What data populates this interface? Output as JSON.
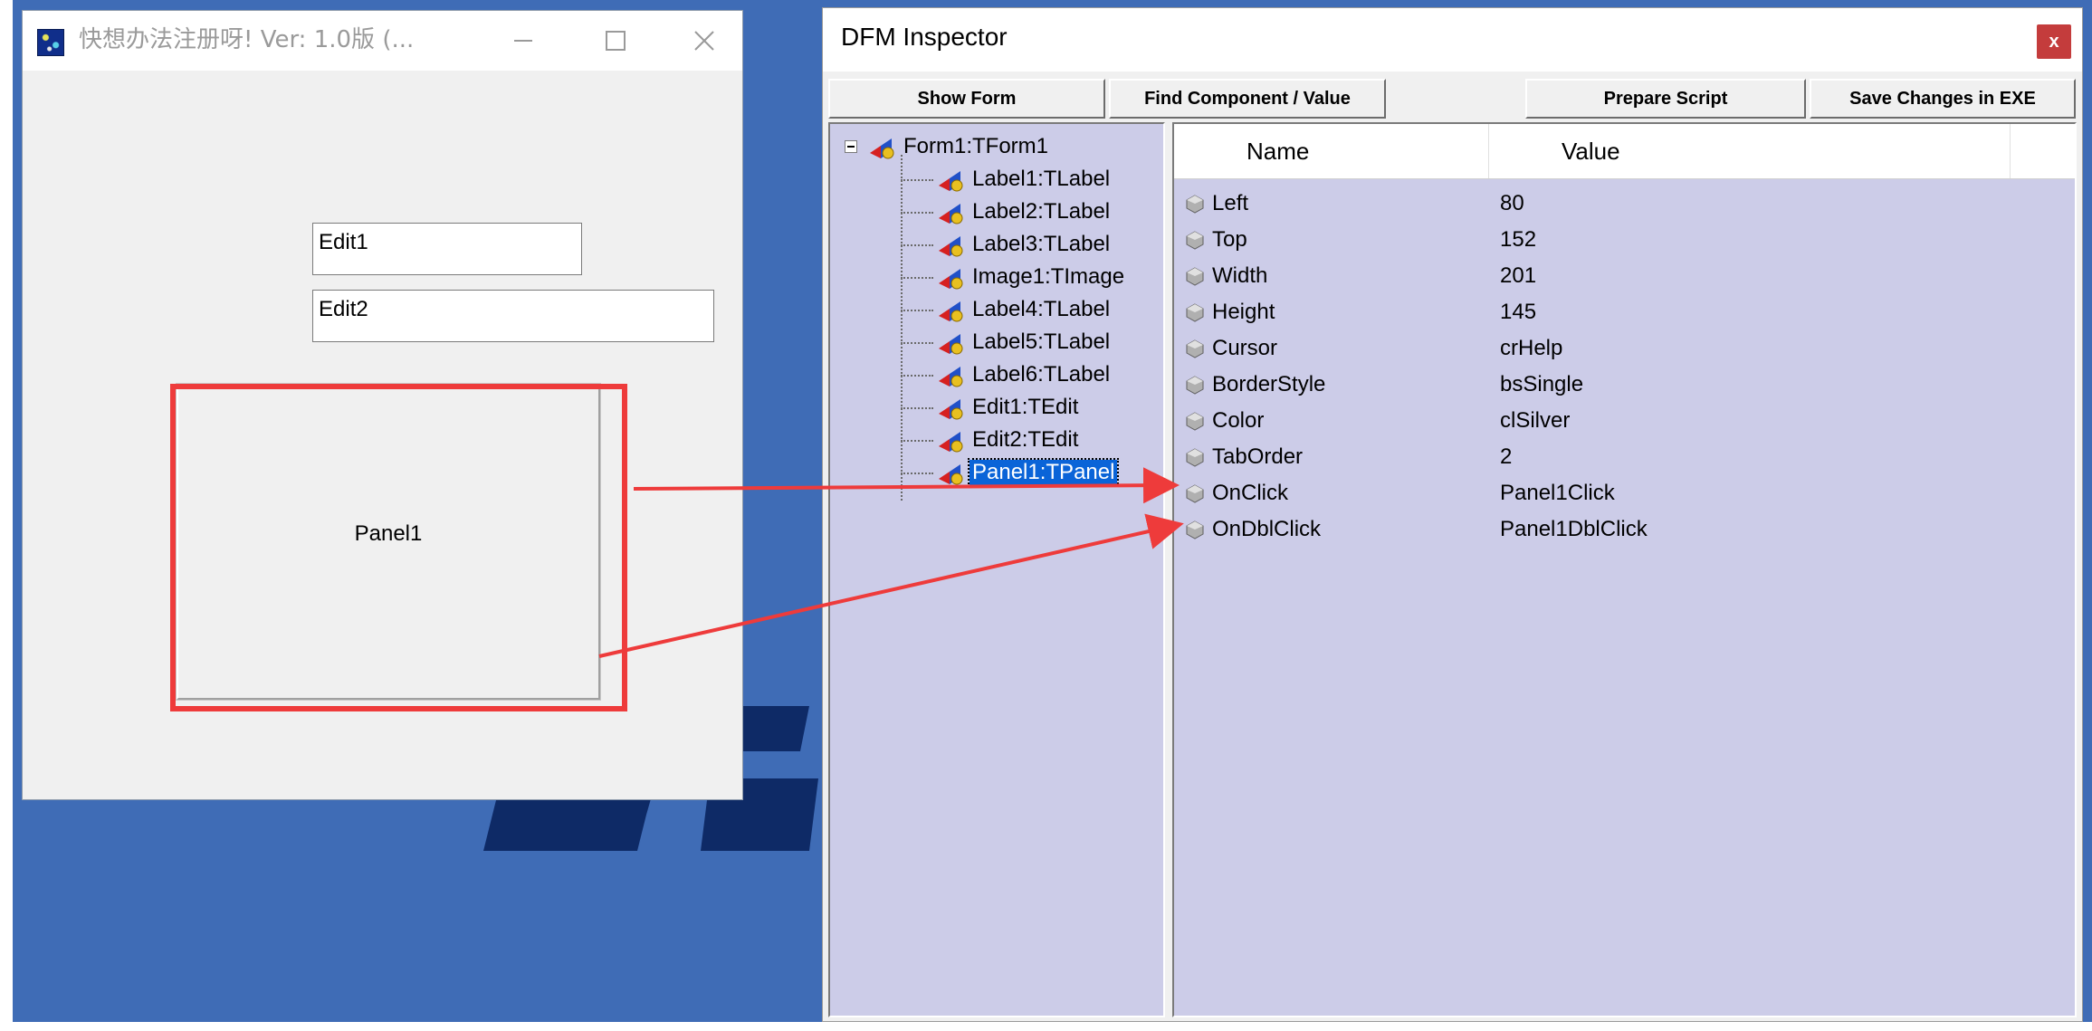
{
  "app_window": {
    "title": "快想办法注册呀!  Ver: 1.0版 (...",
    "edit1_text": "Edit1",
    "edit2_text": "Edit2",
    "panel_caption": "Panel1"
  },
  "dfm_inspector": {
    "title": "DFM Inspector",
    "close_label": "x",
    "buttons": {
      "show_form": "Show Form",
      "find_component": "Find Component / Value",
      "prepare_script": "Prepare Script",
      "save_changes": "Save Changes in EXE"
    },
    "tree": {
      "root": "Form1:TForm1",
      "children": [
        "Label1:TLabel",
        "Label2:TLabel",
        "Label3:TLabel",
        "Image1:TImage",
        "Label4:TLabel",
        "Label5:TLabel",
        "Label6:TLabel",
        "Edit1:TEdit",
        "Edit2:TEdit",
        "Panel1:TPanel"
      ],
      "selected": "Panel1:TPanel"
    },
    "properties": {
      "headers": {
        "name": "Name",
        "value": "Value"
      },
      "rows": [
        {
          "name": "Left",
          "value": "80"
        },
        {
          "name": "Top",
          "value": "152"
        },
        {
          "name": "Width",
          "value": "201"
        },
        {
          "name": "Height",
          "value": "145"
        },
        {
          "name": "Cursor",
          "value": "crHelp"
        },
        {
          "name": "BorderStyle",
          "value": "bsSingle"
        },
        {
          "name": "Color",
          "value": "clSilver"
        },
        {
          "name": "TabOrder",
          "value": "2"
        },
        {
          "name": "OnClick",
          "value": "Panel1Click"
        },
        {
          "name": "OnDblClick",
          "value": "Panel1DblClick"
        }
      ]
    }
  },
  "colors": {
    "desktop": "#3f6cb6",
    "pane_bg": "#cccce8",
    "selection": "#0a64d8",
    "annotation_red": "#ee3b3b"
  },
  "icons": [
    "app-icon",
    "minimize-icon",
    "maximize-icon",
    "close-icon",
    "component-icon",
    "property-gem-icon",
    "tree-collapse-icon"
  ]
}
